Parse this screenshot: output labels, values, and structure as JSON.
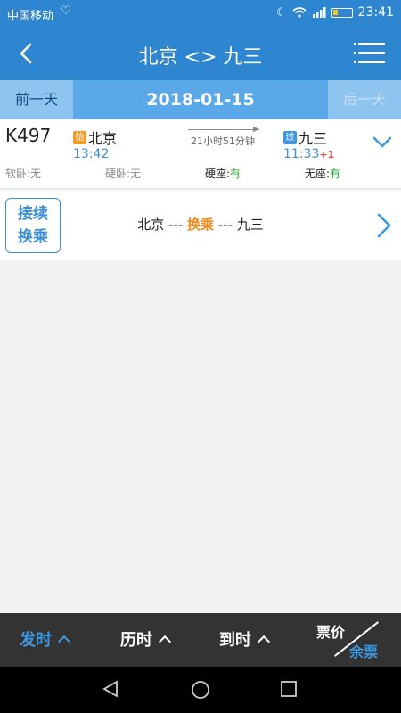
{
  "status_bar": {
    "carrier": "中国移动",
    "time": "23:41"
  },
  "header": {
    "title": "北京 <> 九三"
  },
  "date_bar": {
    "prev_label": "前一天",
    "date": "2018-01-15",
    "next_label": "后一天"
  },
  "train": {
    "number": "K497",
    "from_tag": "始",
    "from_station": "北京",
    "depart_time": "13:42",
    "duration": "21小时51分钟",
    "to_tag": "过",
    "to_station": "九三",
    "arrive_time": "11:33",
    "day_offset": "+1",
    "seats": [
      {
        "label": "软卧:",
        "value": "无"
      },
      {
        "label": "硬卧:",
        "value": "无"
      },
      {
        "label": "硬座:",
        "value": "有"
      },
      {
        "label": "无座:",
        "value": "有"
      }
    ]
  },
  "transfer": {
    "badge_line1": "接续",
    "badge_line2": "换乘",
    "from": "北京",
    "sep1": " --- ",
    "mid": "换乘",
    "sep2": " --- ",
    "to": "九三"
  },
  "bottom_tabs": {
    "depart": "发时",
    "duration": "历时",
    "arrive": "到时",
    "price": "票价",
    "remain": "余票"
  },
  "colors": {
    "primary": "#2f86d0",
    "accent": "#3d98e0",
    "available": "#2c9e3a",
    "transfer_highlight": "#f08a1a"
  }
}
